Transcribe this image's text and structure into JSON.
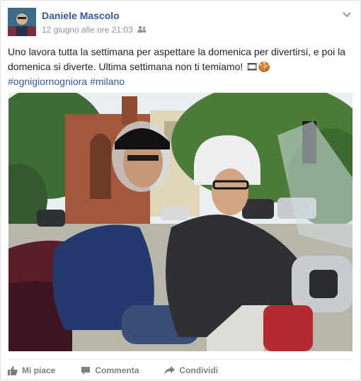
{
  "post": {
    "author": "Daniele Mascolo",
    "timestamp": "12 giugno alle ore 21:03",
    "audience_icon": "friends-icon",
    "menu_icon": "chevron-down-icon",
    "message": "Uno lavora tutta la settimana per aspettare la domenica per divertirsi, e poi la domenica si diverte. Ultima settimana non ti temiamo! 🎞🍪",
    "hashtags": [
      "#ognigiornogniora",
      "#milano"
    ]
  },
  "actions": {
    "like": "Mi piace",
    "comment": "Commenta",
    "share": "Condividi"
  },
  "colors": {
    "link": "#365899",
    "meta": "#90949c",
    "action": "#7f7f7f"
  }
}
